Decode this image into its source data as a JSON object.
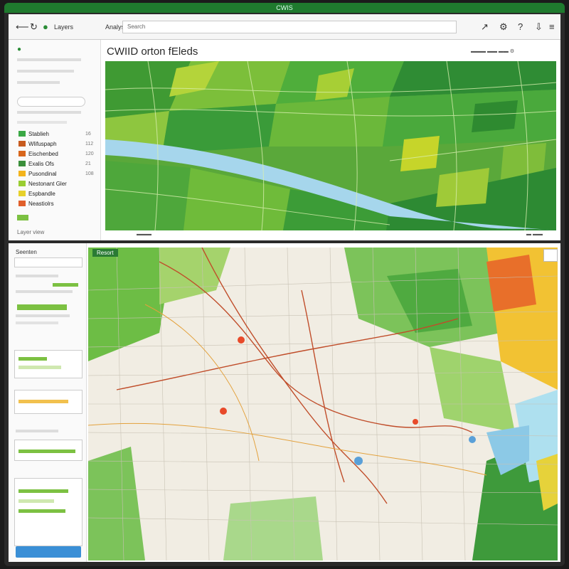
{
  "window": {
    "title": "CWIS"
  },
  "toolbar": {
    "tab1": "Layers",
    "tab2": "Analysis",
    "address": "Search"
  },
  "top_panel": {
    "map_title": "CWIID orton fEleds",
    "legend": [
      {
        "label": "Stablieh",
        "color": "#3aa845",
        "count": "16"
      },
      {
        "label": "Wlifuspaph",
        "color": "#c75b1f",
        "count": "112"
      },
      {
        "label": "Eischenbed",
        "color": "#d8661c",
        "count": "120"
      },
      {
        "label": "Exalis Ofs",
        "color": "#3b8f3b",
        "count": "21"
      },
      {
        "label": "Pusondinal",
        "color": "#f3b41c",
        "count": "108"
      },
      {
        "label": "Nestonant Gler",
        "color": "#9acd32",
        "count": ""
      },
      {
        "label": "Espbandle",
        "color": "#e7d12a",
        "count": ""
      },
      {
        "label": "Neastiolrs",
        "color": "#e05f2b",
        "count": ""
      }
    ],
    "footer": "Layer view"
  },
  "bottom_panel": {
    "sidebar_title": "Seenten",
    "tab": "Resort"
  },
  "colors": {
    "accent": "#1f7a2e",
    "field_light": "#8dc63f",
    "field_dark": "#2d8c32",
    "river": "#9fd3e8"
  }
}
